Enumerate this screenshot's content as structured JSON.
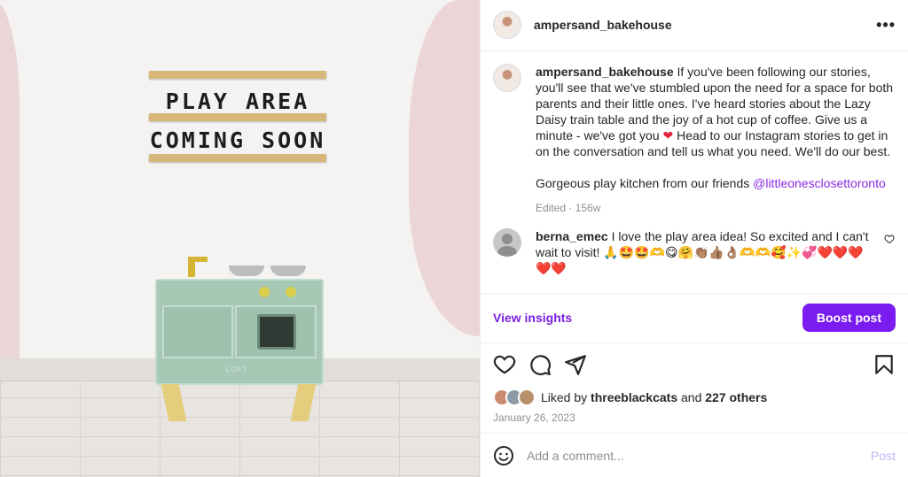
{
  "post": {
    "username": "ampersand_bakehouse",
    "more_icon": "more-horizontal-icon"
  },
  "photo": {
    "sign_line_1": "PLAY AREA",
    "sign_line_2": "COMING SOON",
    "toy_logo": "LOFT"
  },
  "caption": {
    "username": "ampersand_bakehouse",
    "text_before_heart": "If you've been following our stories, you'll see that we've stumbled upon the need for a space for both parents and their little ones. I've heard stories about the Lazy Daisy train table and the joy of a hot cup of coffee. Give us a minute - we've got you",
    "heart": "❤",
    "text_after_heart": "Head to our Instagram stories to get in on the conversation and tell us what you need. We'll do our best.",
    "second_paragraph": "Gorgeous play kitchen from our friends",
    "mention": "@littleonesclosettoronto",
    "meta": "Edited · 156w"
  },
  "comments": [
    {
      "username": "berna_emec",
      "text": "I love the play area idea! So excited and I can't wait to visit! 🙏🤩🤩🫶😋🤗👏🏽👍🏽👌🏽🫶🫶🥰✨💞❤️❤️❤️❤️❤️"
    }
  ],
  "insights": {
    "view_label": "View insights",
    "boost_label": "Boost post"
  },
  "likes": {
    "prefix": "Liked by",
    "first_user": "threeblackcats",
    "and": "and",
    "others": "227 others",
    "date": "January 26, 2023"
  },
  "add_comment": {
    "placeholder": "Add a comment...",
    "post_label": "Post"
  },
  "colors": {
    "accent": "#7a1cf0",
    "link": "#8a2be2",
    "heart": "#e0243b"
  }
}
